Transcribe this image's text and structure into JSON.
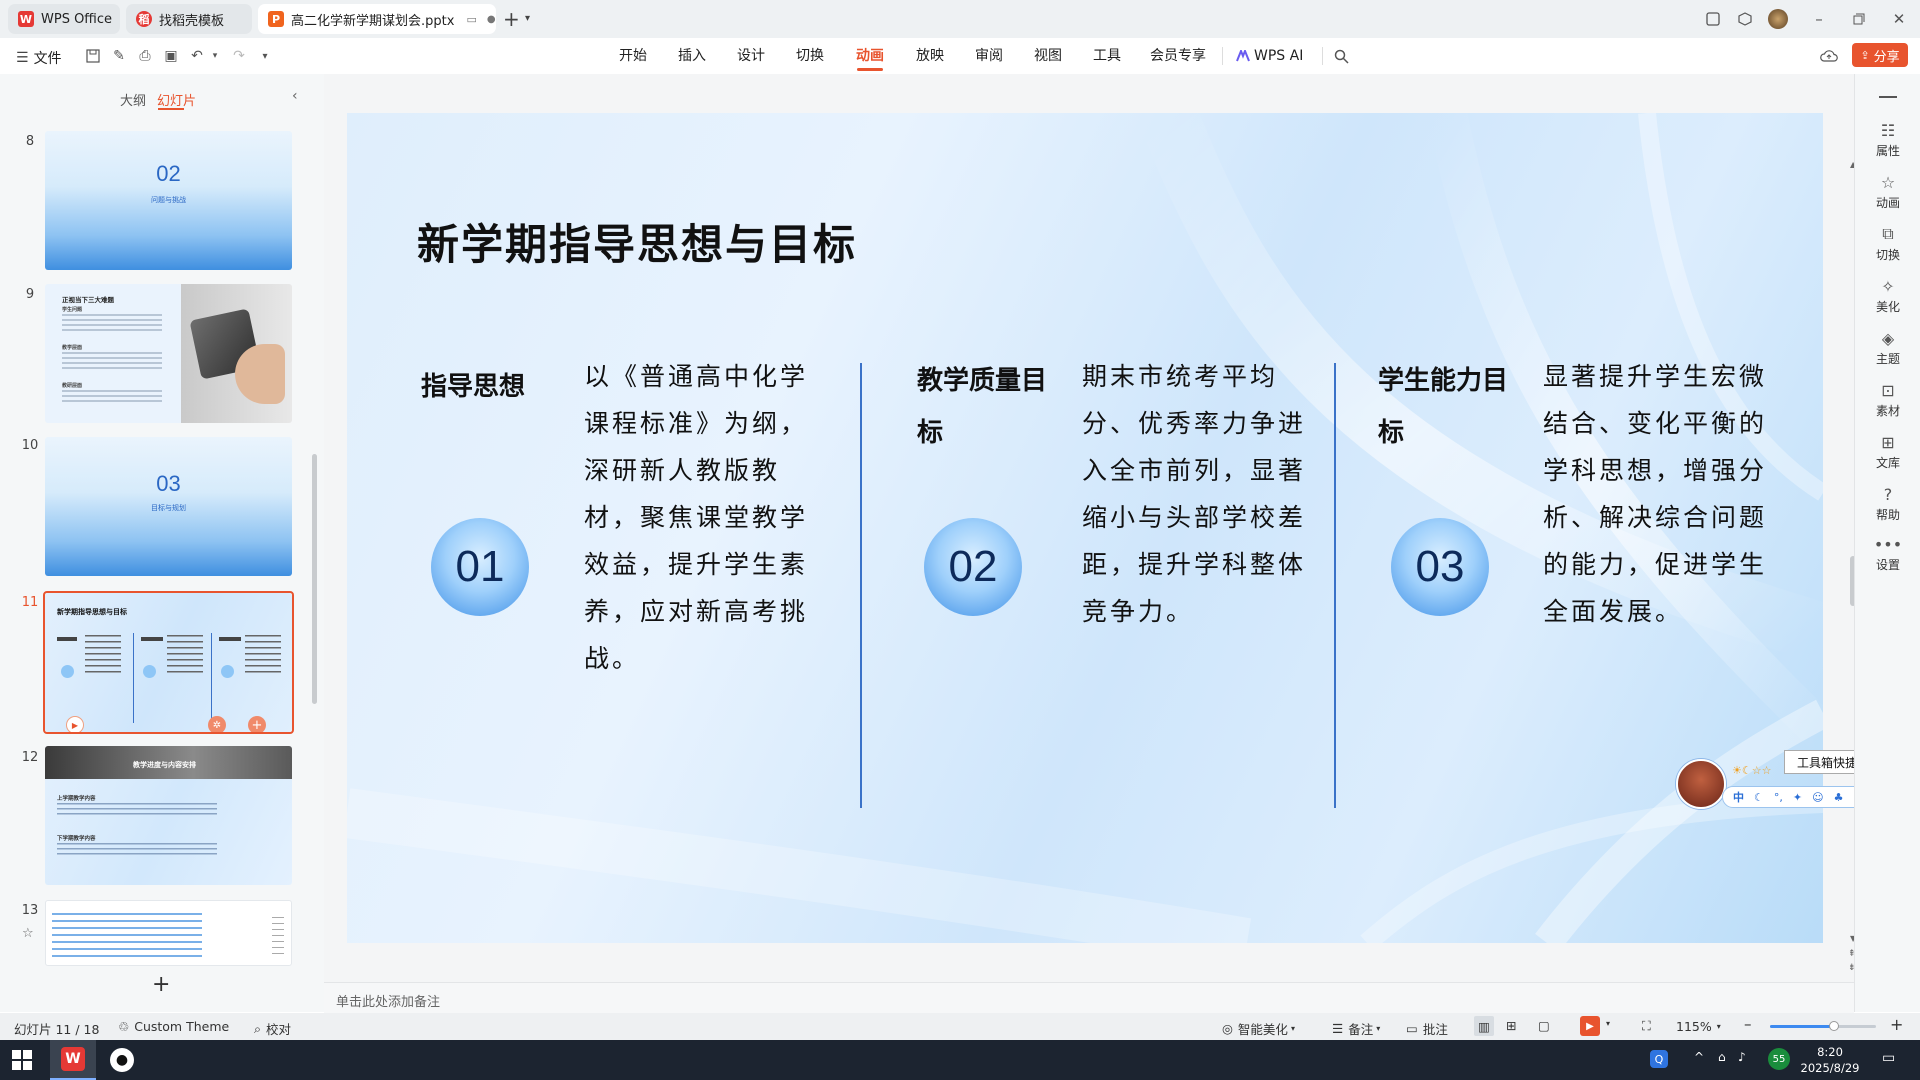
{
  "titlebar": {
    "tabs": [
      {
        "label": "WPS Office",
        "icon": "wps-logo-icon"
      },
      {
        "label": "找稻壳模板",
        "icon": "docer-icon"
      },
      {
        "label": "高二化学新学期谋划会.pptx",
        "icon": "presentation-file-icon"
      }
    ],
    "new_tab_label": "+"
  },
  "menubar": {
    "file_label": "文件",
    "tabs": [
      "开始",
      "插入",
      "设计",
      "切换",
      "动画",
      "放映",
      "审阅",
      "视图",
      "工具",
      "会员专享",
      "WPS AI"
    ],
    "active_tab": "动画",
    "share_label": "分享",
    "accent_color": "#e8542e"
  },
  "leftpanel": {
    "outline_label": "大纲",
    "slides_label": "幻灯片",
    "thumbnails": [
      {
        "number": "8",
        "big": "02",
        "caption": "问题与挑战"
      },
      {
        "number": "9",
        "title": "正视当下三大难题",
        "sub1": "学生问题",
        "sub2": "教学层面",
        "sub3": "教研层面"
      },
      {
        "number": "10",
        "big": "03",
        "caption": "目标与规划"
      },
      {
        "number": "11",
        "title": "新学期指导思想与目标"
      },
      {
        "number": "12",
        "title": "教学进度与内容安排",
        "sub1": "上学期教学内容",
        "sub2": "下学期教学内容"
      },
      {
        "number": "13"
      }
    ],
    "add_label": "+"
  },
  "slide": {
    "title": "新学期指导思想与目标",
    "columns": [
      {
        "heading": "指导思想",
        "number": "01",
        "body": "以《普通高中化学课程标准》为纲，深研新人教版教材，聚焦课堂教学效益，提升学生素养，应对新高考挑战。"
      },
      {
        "heading": "教学质量目标",
        "number": "02",
        "body": "期末市统考平均分、优秀率力争进入全市前列，显著缩小与头部学校差距，提升学科整体竞争力。"
      },
      {
        "heading": "学生能力目标",
        "number": "03",
        "body": "显著提升学生宏微结合、变化平衡的学科思想，增强分析、解决综合问题的能力，促进学生全面发展。"
      }
    ]
  },
  "rightpanel": {
    "items": [
      {
        "label": "属性",
        "icon": "properties-icon"
      },
      {
        "label": "动画",
        "icon": "animation-star-icon"
      },
      {
        "label": "切换",
        "icon": "transition-icon"
      },
      {
        "label": "美化",
        "icon": "beautify-icon"
      },
      {
        "label": "主题",
        "icon": "theme-icon"
      },
      {
        "label": "素材",
        "icon": "material-icon"
      },
      {
        "label": "文库",
        "icon": "library-icon"
      },
      {
        "label": "帮助",
        "icon": "help-icon"
      },
      {
        "label": "设置",
        "icon": "more-icon"
      }
    ]
  },
  "floating": {
    "tooltip": "工具箱快捷入口",
    "ime_label": "中"
  },
  "notes": {
    "placeholder": "单击此处添加备注"
  },
  "statusbar": {
    "slide_counter": "幻灯片 11 / 18",
    "theme": "Custom Theme",
    "proofread": "校对",
    "smart_beautify": "智能美化",
    "notes_label": "备注",
    "comment_label": "批注",
    "zoom": "115%",
    "zoom_fraction": 0.6
  },
  "taskbar": {
    "time": "8:20",
    "date": "2025/8/29",
    "temp": "55"
  }
}
